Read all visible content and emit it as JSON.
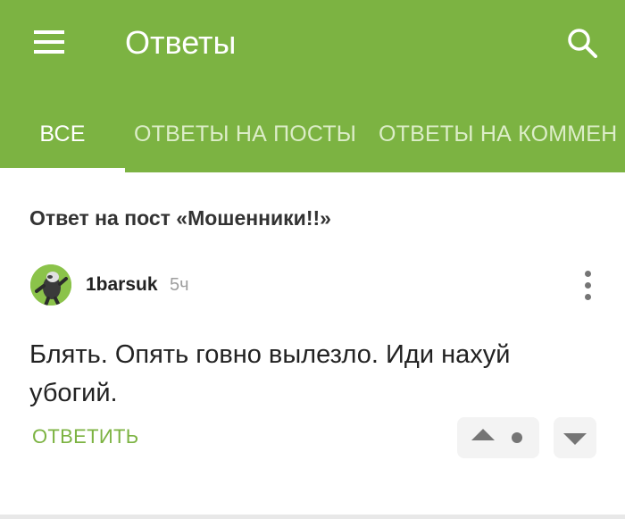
{
  "app_bar": {
    "title": "Ответы",
    "menu_icon": "hamburger-menu-icon",
    "search_icon": "search-icon",
    "background_color": "#7cb342"
  },
  "tabs": [
    {
      "label": "ВСЕ",
      "active": true
    },
    {
      "label": "ОТВЕТЫ НА ПОСТЫ",
      "active": false
    },
    {
      "label": "ОТВЕТЫ НА КОММЕН",
      "active": false
    }
  ],
  "reply": {
    "post_reference": "Ответ на пост «Мошенники!!»",
    "author": "1barsuk",
    "time": "5ч",
    "text": "Блять. Опять говно вылезло. Иди нахуй убогий.",
    "reply_label": "ОТВЕТИТЬ",
    "more_icon": "more-vertical-icon",
    "upvote_icon": "arrow-up-icon",
    "downvote_icon": "arrow-down-icon",
    "accent_color": "#7cb342"
  }
}
